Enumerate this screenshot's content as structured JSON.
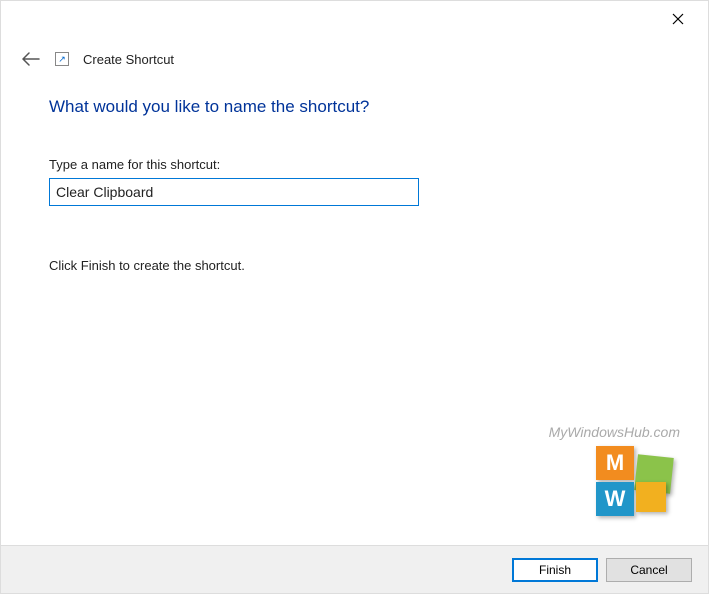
{
  "header": {
    "title": "Create Shortcut"
  },
  "content": {
    "heading": "What would you like to name the shortcut?",
    "field_label": "Type a name for this shortcut:",
    "input_value": "Clear Clipboard",
    "hint": "Click Finish to create the shortcut."
  },
  "watermark": {
    "text": "MyWindowsHub.com",
    "letters": {
      "tl": "M",
      "bl": "W"
    }
  },
  "buttons": {
    "finish": "Finish",
    "cancel": "Cancel"
  }
}
